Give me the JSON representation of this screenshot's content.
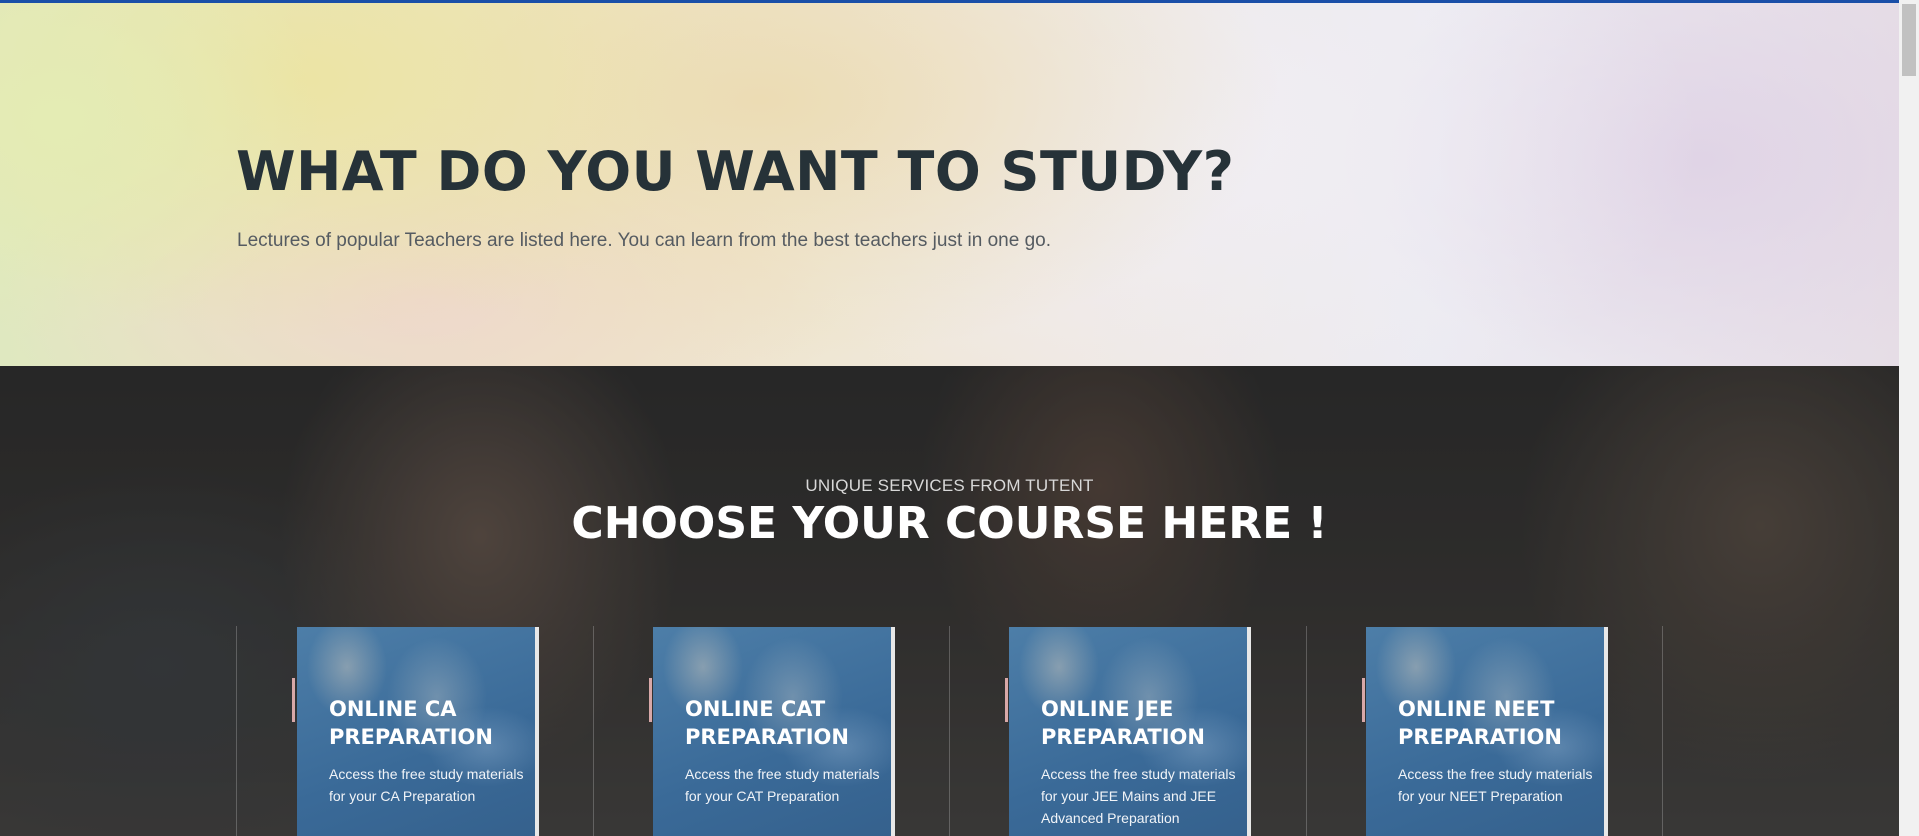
{
  "hero": {
    "title": "WHAT DO YOU WANT TO STUDY?",
    "subtitle": "Lectures of popular Teachers are listed here. You can learn from the best teachers just in one go."
  },
  "courses": {
    "kicker": "UNIQUE SERVICES FROM TUTENT",
    "title": "CHOOSE YOUR COURSE HERE !",
    "cards": [
      {
        "title": "ONLINE CA PREPARATION",
        "description": "Access the free study materials for your CA Preparation"
      },
      {
        "title": "ONLINE CAT PREPARATION",
        "description": "Access the free study materials for your CAT Preparation"
      },
      {
        "title": "ONLINE JEE PREPARATION",
        "description": "Access the free study materials for your JEE Mains and JEE Advanced Preparation"
      },
      {
        "title": "ONLINE NEET PREPARATION",
        "description": "Access the free study materials for your NEET Preparation"
      }
    ]
  },
  "colors": {
    "accent_top_line": "#1a4fa8",
    "hero_title": "#263238",
    "card_bg": "#3a6a98"
  }
}
